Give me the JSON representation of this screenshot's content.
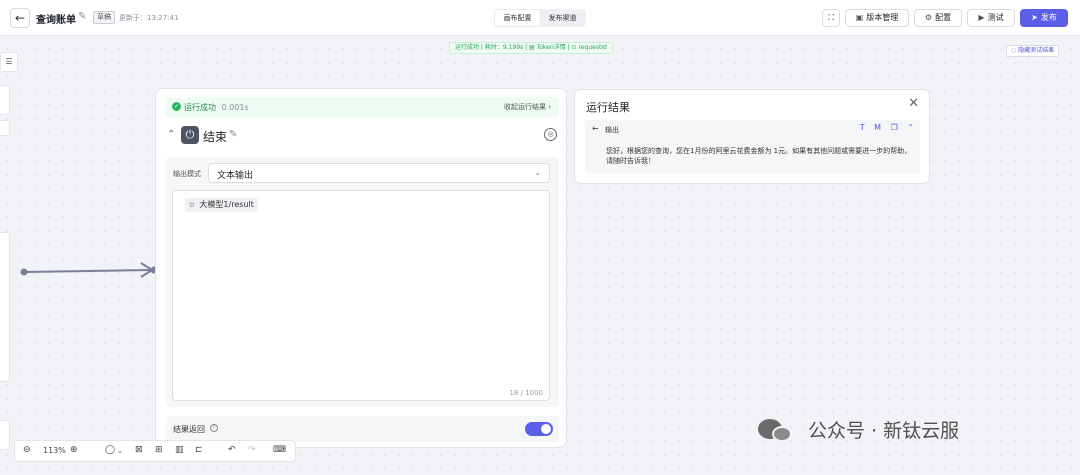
{
  "header": {
    "back_icon": "arrow-left-icon",
    "title": "查询账单",
    "status_badge": "草稿",
    "updated_at": "更新于：13:27:41",
    "tabs": [
      {
        "label": "画布配置",
        "active": true
      },
      {
        "label": "发布渠道",
        "active": false
      }
    ],
    "buttons": {
      "version": "版本管理",
      "config": "配置",
      "test": "测试",
      "publish": "发布"
    },
    "accent_color": "#5b5fe8"
  },
  "run_status": {
    "summary": "运行成功 | 耗时：9.199s",
    "token_detail": "Token详情",
    "request_id": "requestId",
    "hide_results": "隐藏测试结果"
  },
  "end_node": {
    "status": "运行成功",
    "duration": "0.001s",
    "collapse_results": "收起运行结果",
    "title": "结束",
    "output_mode_label": "输出模式",
    "output_mode_value": "文本输出",
    "variable_chip": "大模型1/result",
    "char_count": "18 / 1000",
    "return_label": "结果返回",
    "return_enabled": true
  },
  "results_panel": {
    "title": "运行结果",
    "output_label": "输出",
    "tools": [
      "T",
      "M"
    ],
    "output_text": "您好，根据您的查询，您在1月份的阿里云花费金额为          1元。如果有其他问题或需要进一步的帮助，请随时告诉我！"
  },
  "zoom_toolbar": {
    "zoom_level": "113%"
  },
  "watermark": {
    "text": "公众号 · 新钛云服"
  }
}
